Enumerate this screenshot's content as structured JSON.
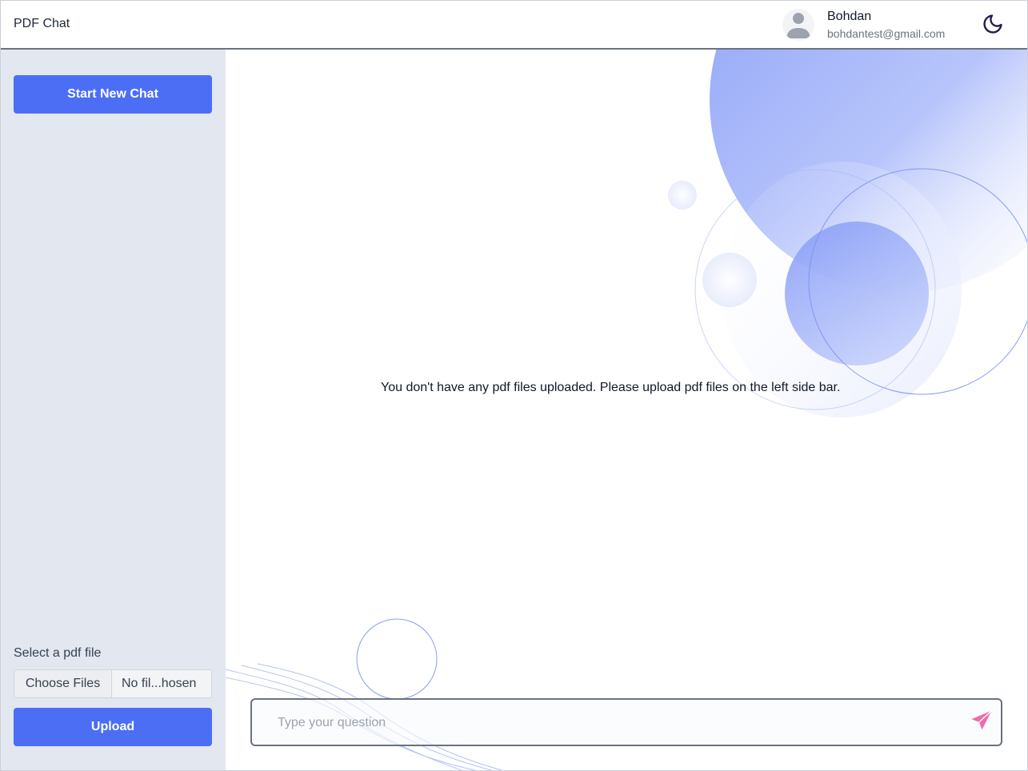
{
  "header": {
    "app_title": "PDF Chat",
    "user": {
      "name": "Bohdan",
      "email": "bohdantest@gmail.com"
    },
    "theme_toggle_icon": "moon-icon"
  },
  "sidebar": {
    "new_chat_label": "Start New Chat",
    "select_label": "Select a pdf file",
    "file_input": {
      "button_label": "Choose Files",
      "status_text": "No fil...hosen"
    },
    "upload_label": "Upload"
  },
  "main": {
    "empty_message": "You don't have any pdf files uploaded. Please upload pdf files on the left side bar.",
    "question_placeholder": "Type your question",
    "send_icon": "paper-plane-icon"
  },
  "colors": {
    "accent": "#4c6ef5",
    "sidebar_bg": "#e2e7f0",
    "send_icon": "#f06ba8"
  }
}
